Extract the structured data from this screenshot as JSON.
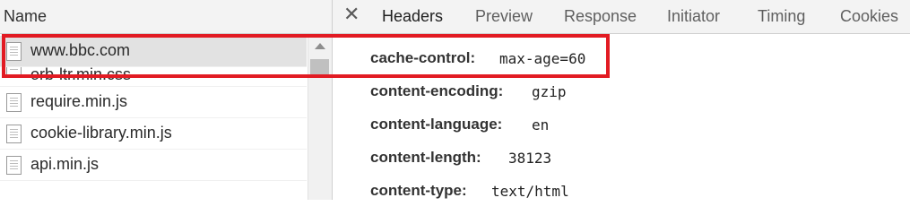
{
  "network": {
    "column_name": "Name",
    "files": [
      {
        "name": "www.bbc.com",
        "icon": "document-icon",
        "selected": true
      },
      {
        "name": "orb-ltr.min.css",
        "icon": "document-icon",
        "selected": false
      },
      {
        "name": "require.min.js",
        "icon": "document-icon",
        "selected": false
      },
      {
        "name": "cookie-library.min.js",
        "icon": "document-icon",
        "selected": false
      },
      {
        "name": "api.min.js",
        "icon": "document-icon",
        "selected": false
      }
    ]
  },
  "details": {
    "close_symbol": "✕",
    "tabs": [
      "Headers",
      "Preview",
      "Response",
      "Initiator",
      "Timing",
      "Cookies"
    ],
    "active_tab": "Headers",
    "headers": [
      {
        "name": "cache-control:",
        "value": "max-age=60"
      },
      {
        "name": "content-encoding:",
        "value": "gzip"
      },
      {
        "name": "content-language:",
        "value": "en"
      },
      {
        "name": "content-length:",
        "value": "38123"
      },
      {
        "name": "content-type:",
        "value": "text/html"
      }
    ]
  },
  "colors": {
    "highlight": "#e21b23",
    "selected_row": "#e2e2e2",
    "header_bar": "#f3f3f3"
  }
}
